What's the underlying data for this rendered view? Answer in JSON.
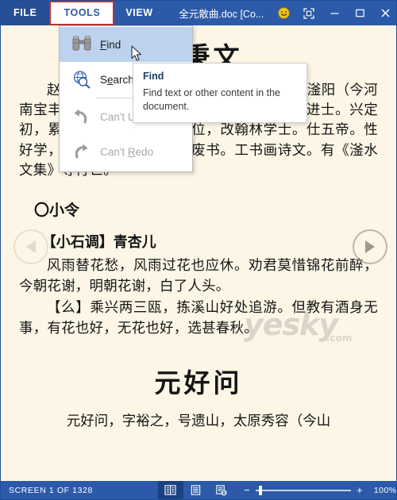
{
  "window": {
    "doc_title": "全元散曲.doc [Co...",
    "tabs": [
      {
        "label": "FILE",
        "state": "file"
      },
      {
        "label": "TOOLS",
        "state": "active"
      },
      {
        "label": "VIEW",
        "state": "normal"
      }
    ],
    "buttons": {
      "smiley": "🙂",
      "smiley_name": "feedback-smiley-icon",
      "fullscreen": "fullscreen-icon",
      "minimize": "minimize-icon",
      "restore": "restore-icon",
      "close": "close-icon"
    },
    "colors": {
      "ribbon_blue": "#2c5aa8",
      "file_tab_blue": "#264f94",
      "active_tab_outline": "#c0302b",
      "page_cream": "#fdf6e6",
      "menu_highlight": "#bcd2ee"
    }
  },
  "tools_menu": {
    "items": [
      {
        "label_pre": "",
        "label_underline": "F",
        "label_post": "ind",
        "icon": "binoculars-icon",
        "state": "highlight",
        "name": "find"
      },
      {
        "label_pre": "S",
        "label_underline": "e",
        "label_post": "arch with Bing",
        "icon": "globe-search-icon",
        "state": "normal",
        "name": "search-with-bing"
      },
      {
        "label_pre": "Can't U",
        "label_underline": "n",
        "label_post": "do",
        "icon": "undo-arrow-icon",
        "state": "disabled",
        "name": "undo"
      },
      {
        "label_pre": "Can't ",
        "label_underline": "R",
        "label_post": "edo",
        "icon": "redo-arrow-icon",
        "state": "disabled",
        "name": "redo"
      }
    ]
  },
  "tooltip": {
    "title": "Find",
    "body": "Find text or other content in the document."
  },
  "document": {
    "title_1": "赵秉文",
    "para_1": "赵秉文（一一五九~一二三二），金末元初滏阳（今河南宝丰县南）人，字周臣，号闲闲老人，大定进士。兴定初，累拜礼部尚书。哀宗即位，改翰林学士。仕五帝。性好学，自幼至老，未尝一日废书。工书画诗文。有《滏水文集》等行世。",
    "section_1": "〇小令",
    "subheading_1": "【小石调】青杏儿",
    "para_2": "风雨替花愁，风雨过花也应休。劝君莫惜锦花前醉，今朝花谢，明朝花谢，白了人头。",
    "para_3": "【么】乘兴两三瓯，拣溪山好处追游。但教有酒身无事，有花也好，无花也好，选甚春秋。",
    "title_2": "元好问",
    "para_4": "元好问，字裕之，号遗山，太原秀容（今山",
    "watermark": "yesky",
    "watermark_domain": ".com"
  },
  "nav": {
    "prev": "previous-page",
    "next": "next-page"
  },
  "statusbar": {
    "screen_text": "SCREEN 1 OF 1328",
    "views": [
      {
        "name": "read-mode-view",
        "icon": "book-icon",
        "active": true
      },
      {
        "name": "print-layout-view",
        "icon": "page-icon",
        "active": false
      },
      {
        "name": "web-layout-view",
        "icon": "web-page-icon",
        "active": false
      }
    ],
    "zoom_out": "−",
    "zoom_in": "+",
    "zoom_value": "100%"
  }
}
